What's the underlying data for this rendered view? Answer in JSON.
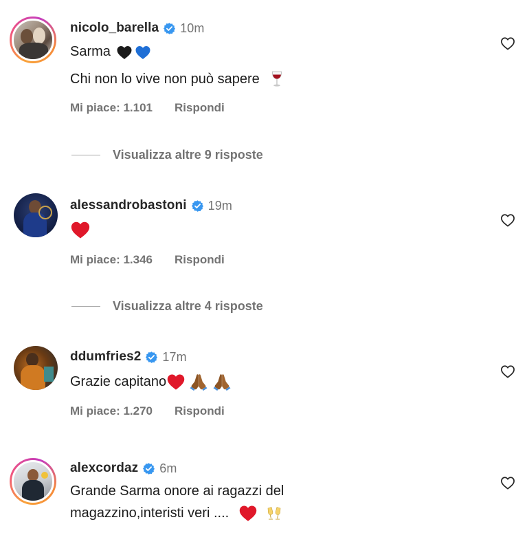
{
  "comments": [
    {
      "username": "nicolo_barella",
      "time": "10m",
      "lines": [
        "Sarma",
        "Chi non lo vive non può sapere"
      ],
      "likes_label": "Mi piace: 1.101",
      "reply_label": "Rispondi",
      "more_replies": "Visualizza altre 9 risposte"
    },
    {
      "username": "alessandrobastoni",
      "time": "19m",
      "lines": [
        ""
      ],
      "likes_label": "Mi piace: 1.346",
      "reply_label": "Rispondi",
      "more_replies": "Visualizza altre 4 risposte"
    },
    {
      "username": "ddumfries2",
      "time": "17m",
      "lines": [
        "Grazie capitano"
      ],
      "likes_label": "Mi piace: 1.270",
      "reply_label": "Rispondi"
    },
    {
      "username": "alexcordaz",
      "time": "6m",
      "lines": [
        "Grande Sarma onore ai ragazzi del",
        "magazzino,interisti veri ...."
      ]
    }
  ],
  "colors": {
    "verified_blue": "#3897f0",
    "secondary_text": "#737373",
    "heart_red": "#e0182a"
  },
  "icons": {
    "verified": "verified-badge-icon",
    "like": "heart-outline-icon",
    "black_heart": "black-heart-emoji",
    "blue_heart": "blue-heart-emoji",
    "red_heart": "red-heart-emoji",
    "wine": "wine-glass-emoji",
    "pray": "folded-hands-emoji",
    "cheers": "clinking-glasses-emoji"
  }
}
